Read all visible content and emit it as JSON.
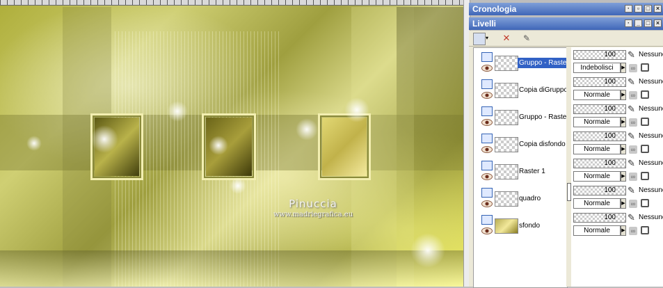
{
  "panels": {
    "history_title": "Cronologia",
    "layers_title": "Livelli"
  },
  "watermark": {
    "name": "Pinuccia",
    "url": "www.madriegrafica.eu"
  },
  "layers": [
    {
      "name": "Gruppo - Raster",
      "opacity": "100",
      "blend": "Indebolisci",
      "link": "Nessuno",
      "selected": true
    },
    {
      "name": "Copia diGruppo",
      "opacity": "100",
      "blend": "Normale",
      "link": "Nessuno"
    },
    {
      "name": "Gruppo - Raster",
      "opacity": "100",
      "blend": "Normale",
      "link": "Nessuno"
    },
    {
      "name": "Copia disfondo",
      "opacity": "100",
      "blend": "Normale",
      "link": "Nessuno"
    },
    {
      "name": "Raster 1",
      "opacity": "100",
      "blend": "Normale",
      "link": "Nessuno"
    },
    {
      "name": "quadro",
      "opacity": "100",
      "blend": "Normale",
      "link": "Nessuno"
    },
    {
      "name": "sfondo",
      "opacity": "100",
      "blend": "Normale",
      "link": "Nessuno"
    }
  ],
  "icons": {
    "pin": "pin-icon",
    "restore": "restore-icon",
    "maximize": "maximize-icon",
    "close": "close-icon",
    "eye": "eye-icon",
    "brush": "brush-icon",
    "lock": "lock-icon"
  }
}
